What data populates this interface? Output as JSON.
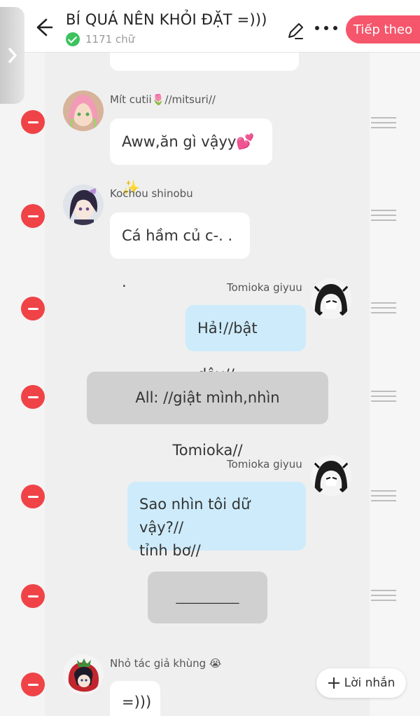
{
  "header": {
    "title": "BÍ QUÁ NÊN KHỎI ĐẶT =)))",
    "word_count": "1171 chữ",
    "next_label": "Tiếp theo",
    "accent_color": "#f5566b",
    "icons": [
      "arrow-left-icon",
      "check-icon",
      "pencil-icon",
      "more-icon"
    ]
  },
  "messages": [
    {
      "type": "left",
      "name": "Mít cutii🌷//mitsuri//",
      "text": "Aww,ăn gì vậyy💕✨"
    },
    {
      "type": "left",
      "name": "Kochou shinobu",
      "text": "Cá hầm củ c-. . ."
    },
    {
      "type": "right",
      "name": "Tomioka giyuu",
      "text": "Hả!//bật dậy//"
    },
    {
      "type": "narration",
      "text": "All: //giật mình,nhìn Tomioka//"
    },
    {
      "type": "right",
      "name": "Tomioka giyuu",
      "text_line1": "Sao nhìn tôi dữ vậy?//",
      "text_line2": "tỉnh bơ//"
    },
    {
      "type": "narration",
      "text": "__________"
    },
    {
      "type": "left",
      "name": "Nhỏ tác giả khùng 😭",
      "text": "=)))"
    }
  ],
  "add_message_label": "Lời nhắn",
  "colors": {
    "remove": "#f04347",
    "bubble_blue": "#cdebfb",
    "bubble_grey": "#d0d0d0"
  }
}
